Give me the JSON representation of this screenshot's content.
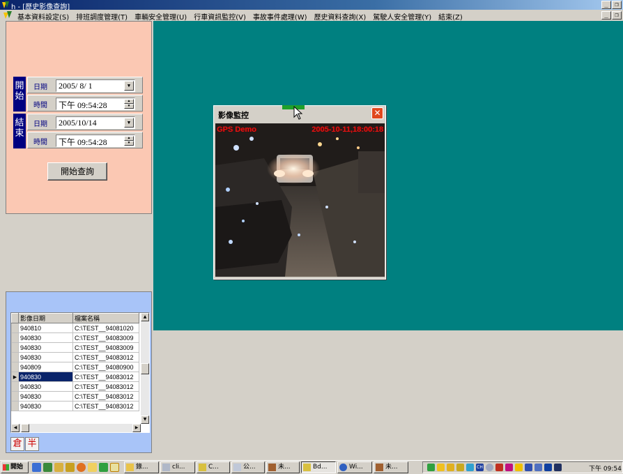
{
  "window": {
    "title": "h - [歷史影像查詢]"
  },
  "menu": {
    "items": [
      "基本資料設定(S)",
      "排班調度管理(T)",
      "車輛安全管理(U)",
      "行車資訊監控(V)",
      "事故事件處理(W)",
      "歷史資料查詢(X)",
      "駕駛人安全管理(Y)",
      "結束(Z)"
    ]
  },
  "query": {
    "start_tag": "開始",
    "end_tag": "結束",
    "date_label": "日期",
    "time_label": "時間",
    "start_date": "2005/ 8/ 1",
    "start_time": "下午 09:54:28",
    "end_date": "2005/10/14",
    "end_time": "下午 09:54:28",
    "search_button": "開始查詢"
  },
  "video_window": {
    "title": "影像監控",
    "overlay_left": "GPS Demo",
    "overlay_right": "2005-10-11,18:00:18",
    "close_glyph": "✕"
  },
  "list": {
    "headers": [
      "影像日期",
      "檔案名稱"
    ],
    "rows": [
      {
        "date": "940810",
        "file": "C:\\TEST__94081020"
      },
      {
        "date": "940830",
        "file": "C:\\TEST__94083009"
      },
      {
        "date": "940830",
        "file": "C:\\TEST__94083009"
      },
      {
        "date": "940830",
        "file": "C:\\TEST__94083012"
      },
      {
        "date": "940809",
        "file": "C:\\TEST__94080900"
      },
      {
        "date": "940830",
        "file": "C:\\TEST__94083012"
      },
      {
        "date": "940830",
        "file": "C:\\TEST__94083012"
      },
      {
        "date": "940830",
        "file": "C:\\TEST__94083012"
      },
      {
        "date": "940830",
        "file": "C:\\TEST__94083012"
      }
    ],
    "selected_index": 5,
    "ime": [
      "倉",
      "半"
    ]
  },
  "taskbar": {
    "start_label": "開始",
    "tasks": [
      {
        "label": "錄..."
      },
      {
        "label": "cli..."
      },
      {
        "label": "C..."
      },
      {
        "label": "公..."
      },
      {
        "label": "未..."
      },
      {
        "label": "Bd..."
      },
      {
        "label": "Wi..."
      },
      {
        "label": "未..."
      }
    ],
    "tray_ime": "CH",
    "clock": "下午 09:54"
  },
  "colors": {
    "workspace": "#008080",
    "query_panel": "#fbc8b3",
    "list_panel": "#a8c4f8",
    "tag_bg": "#000080",
    "overlay_text": "#e01414"
  }
}
